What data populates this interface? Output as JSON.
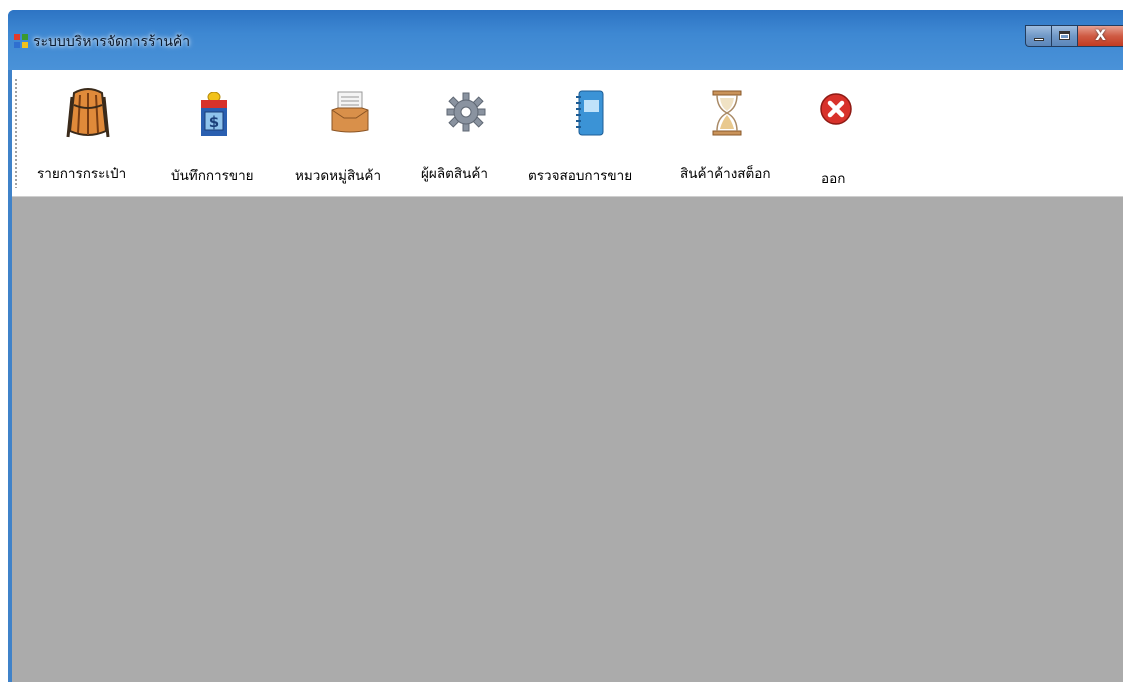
{
  "window": {
    "title": "ระบบบริหารจัดการร้านค้า",
    "caption_buttons": {
      "minimize_icon": "minimize-icon",
      "maximize_icon": "maximize-icon",
      "close_label": "X"
    }
  },
  "toolbar": {
    "items": [
      {
        "label": "รายการกระเป๋า",
        "icon": "backpack-icon"
      },
      {
        "label": "บันทึกการขาย",
        "icon": "money-box-icon"
      },
      {
        "label": "หมวดหมู่สินค้า",
        "icon": "inbox-tray-icon"
      },
      {
        "label": "ผู้ผลิตสินค้า",
        "icon": "gear-icon"
      },
      {
        "label": "ตรวจสอบการขาย",
        "icon": "notebook-icon"
      },
      {
        "label": "สินค้าค้างสต็อก",
        "icon": "hourglass-icon"
      },
      {
        "label": "ออก",
        "icon": "exit-icon"
      }
    ]
  },
  "colors": {
    "titlebar": "#3e88d2",
    "toolbar_bg": "#ffffff",
    "client_bg": "#ababab",
    "close_button": "#c23b22"
  }
}
